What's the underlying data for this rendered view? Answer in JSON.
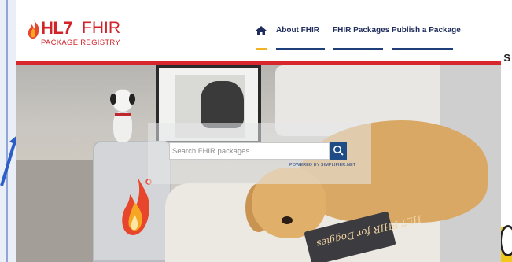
{
  "brand": {
    "hl7": "HL7",
    "fhir": "FHIR",
    "registry": "PACKAGE REGISTRY"
  },
  "nav": {
    "home_icon": "home-icon",
    "items": [
      {
        "label": "About FHIR"
      },
      {
        "label": "FHIR Packages"
      },
      {
        "label": "Publish a Package"
      }
    ]
  },
  "search": {
    "placeholder": "Search FHIR packages...",
    "value": "",
    "button_icon": "search-icon",
    "powered_by": "POWERED BY SIMPLIFIER.NET"
  },
  "hero": {
    "book_title": "HL7 FHIR for Doggies"
  },
  "edge": {
    "right_char": "S"
  },
  "colors": {
    "brand_red": "#d2232a",
    "nav_text": "#1f2d5c",
    "accent_gold": "#f0b323",
    "search_button": "#1f4b87"
  }
}
